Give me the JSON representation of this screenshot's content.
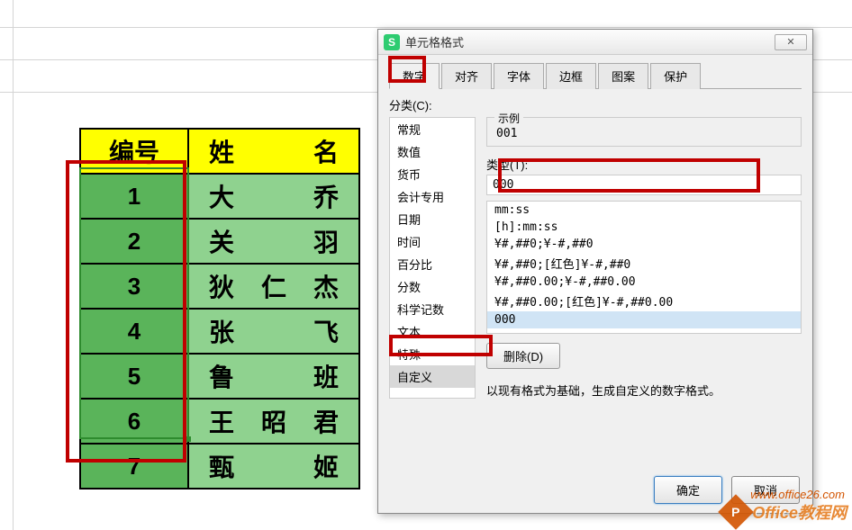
{
  "table": {
    "headers": [
      "编号",
      "姓名"
    ],
    "rows": [
      {
        "id": "1",
        "name": "大　乔"
      },
      {
        "id": "2",
        "name": "关　羽"
      },
      {
        "id": "3",
        "name": "狄仁杰"
      },
      {
        "id": "4",
        "name": "张　飞"
      },
      {
        "id": "5",
        "name": "鲁　班"
      },
      {
        "id": "6",
        "name": "王昭君"
      },
      {
        "id": "7",
        "name": "甄　姬"
      }
    ]
  },
  "dialog": {
    "title": "单元格格式",
    "icon_letter": "S",
    "close_glyph": "✕",
    "tabs": [
      "数字",
      "对齐",
      "字体",
      "边框",
      "图案",
      "保护"
    ],
    "active_tab": 0,
    "category_label": "分类(C):",
    "categories": [
      "常规",
      "数值",
      "货币",
      "会计专用",
      "日期",
      "时间",
      "百分比",
      "分数",
      "科学记数",
      "文本",
      "特殊",
      "自定义"
    ],
    "selected_category": 11,
    "example": {
      "legend": "示例",
      "value": "001"
    },
    "type_label": "类型(T):",
    "type_value": "000",
    "format_items": [
      "mm:ss",
      "[h]:mm:ss",
      "¥#,##0;¥-#,##0",
      "¥#,##0;[红色]¥-#,##0",
      "¥#,##0.00;¥-#,##0.00",
      "¥#,##0.00;[红色]¥-#,##0.00",
      "000"
    ],
    "selected_format": 6,
    "delete_label": "删除(D)",
    "description": "以现有格式为基础，生成自定义的数字格式。",
    "ok_label": "确定",
    "cancel_label": "取消"
  },
  "watermark": {
    "icon_letter": "P",
    "text": "Office教程网",
    "url": "www.office26.com"
  }
}
